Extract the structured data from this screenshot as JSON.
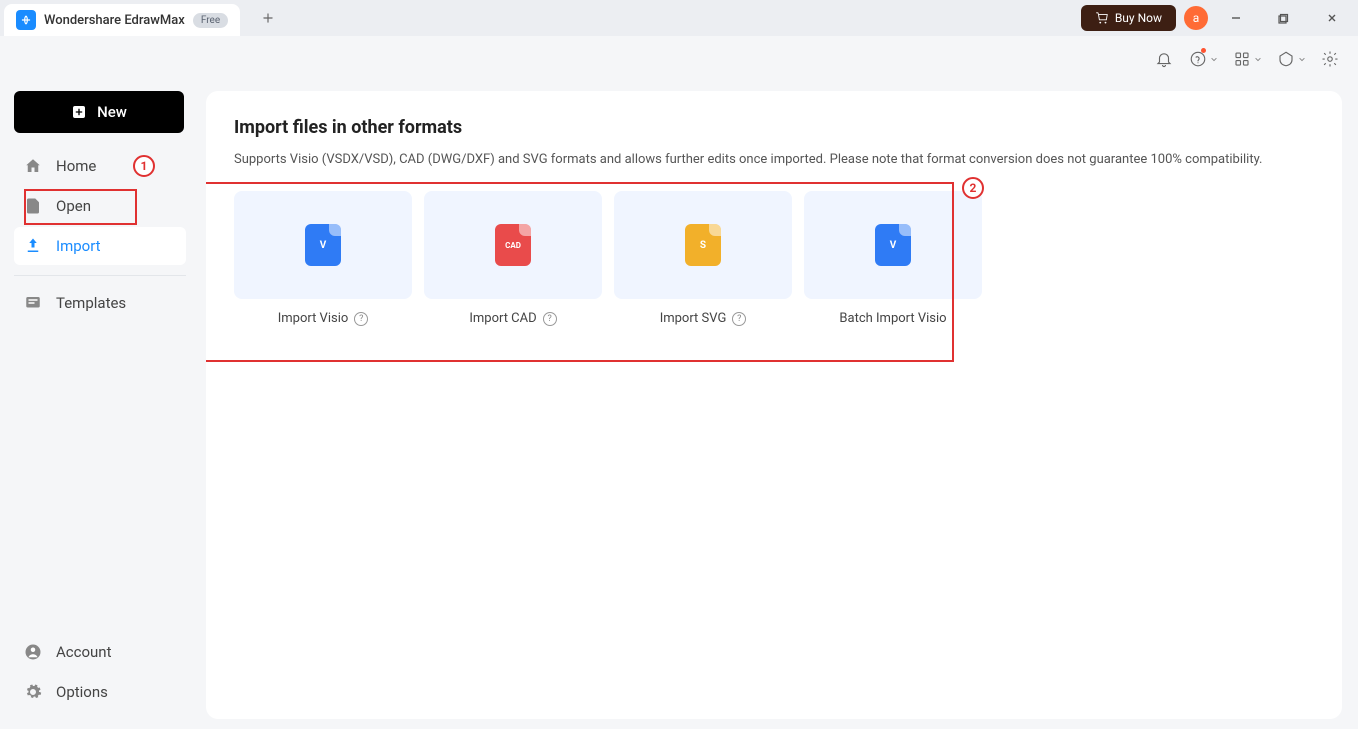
{
  "titlebar": {
    "appName": "Wondershare EdrawMax",
    "badge": "Free",
    "buyNow": "Buy Now",
    "avatarInitial": "a"
  },
  "sidebar": {
    "newButton": "New",
    "items": [
      {
        "label": "Home"
      },
      {
        "label": "Open"
      },
      {
        "label": "Import"
      },
      {
        "label": "Templates"
      }
    ],
    "bottom": [
      {
        "label": "Account"
      },
      {
        "label": "Options"
      }
    ]
  },
  "content": {
    "title": "Import files in other formats",
    "description": "Supports Visio (VSDX/VSD), CAD (DWG/DXF) and SVG formats and allows further edits once imported. Please note that format conversion does not guarantee 100% compatibility.",
    "cards": [
      {
        "label": "Import Visio",
        "iconText": "V",
        "color": "#2f7bf5",
        "hasHelp": true
      },
      {
        "label": "Import CAD",
        "iconText": "CAD",
        "color": "#e94b4b",
        "hasHelp": true
      },
      {
        "label": "Import SVG",
        "iconText": "S",
        "color": "#f2b02a",
        "hasHelp": true
      },
      {
        "label": "Batch Import Visio",
        "iconText": "V",
        "color": "#2f7bf5",
        "hasHelp": false
      }
    ]
  },
  "annotations": {
    "marker1": "1",
    "marker2": "2"
  }
}
